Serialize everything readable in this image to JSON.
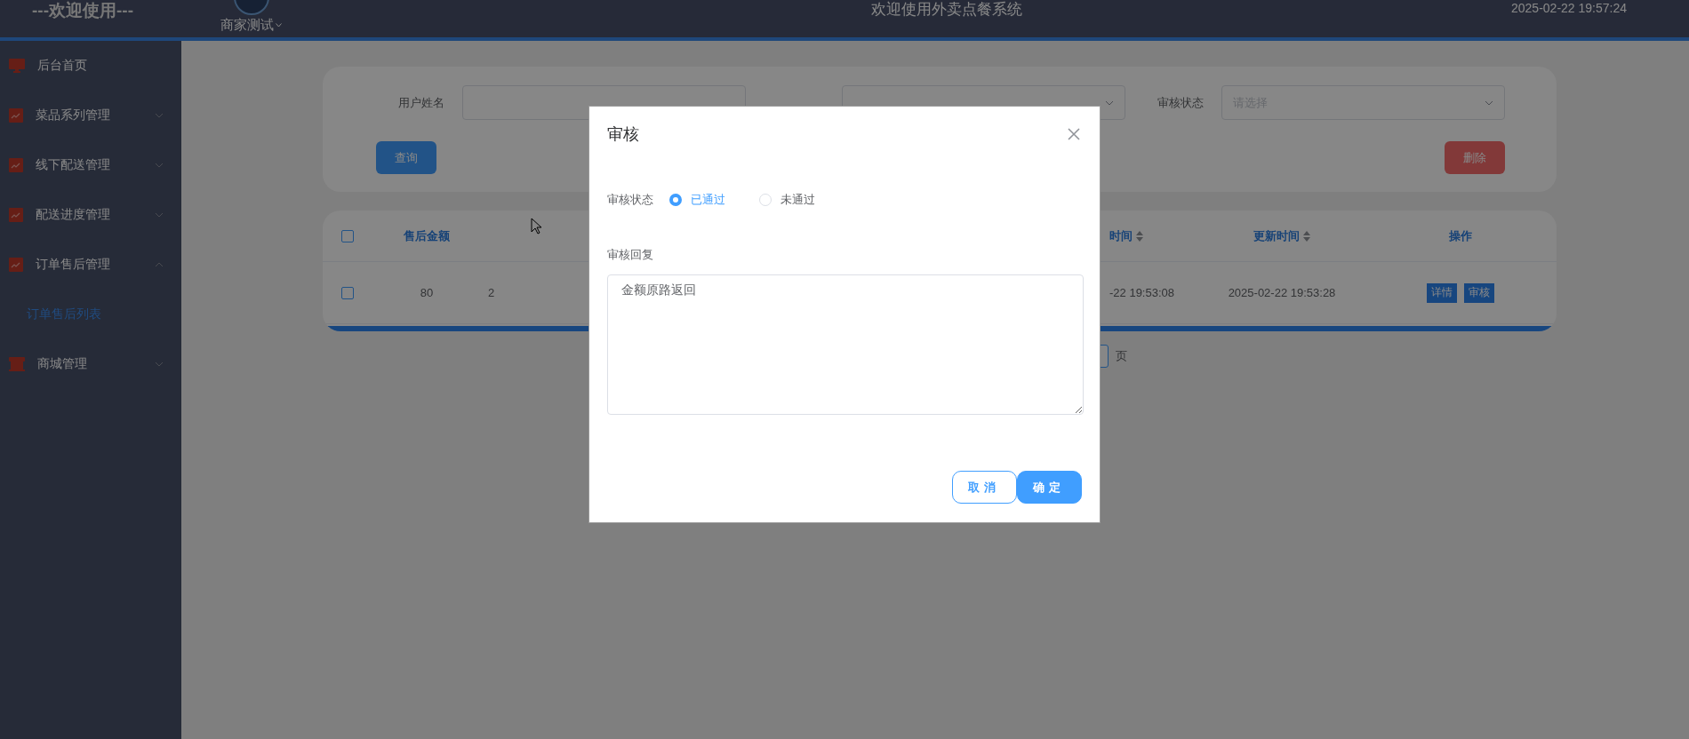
{
  "header": {
    "title": "---欢迎使用---",
    "user": "商家测试",
    "system_name": "欢迎使用外卖点餐系统",
    "datetime": "2025-02-22 19:57:24"
  },
  "sidebar": {
    "items": [
      {
        "label": "后台首页",
        "kind": "page"
      },
      {
        "label": "菜品系列管理",
        "kind": "menu",
        "expanded": false
      },
      {
        "label": "线下配送管理",
        "kind": "menu",
        "expanded": false
      },
      {
        "label": "配送进度管理",
        "kind": "menu",
        "expanded": false
      },
      {
        "label": "订单售后管理",
        "kind": "menu",
        "expanded": true,
        "children": [
          {
            "label": "订单售后列表",
            "selected": true
          }
        ]
      },
      {
        "label": "商城管理",
        "kind": "store",
        "expanded": false
      }
    ]
  },
  "filters": [
    {
      "label": "用户姓名",
      "kind": "text"
    },
    {
      "kind": "select"
    },
    {
      "label": "审核状态",
      "kind": "select",
      "placeholder": "请选择"
    }
  ],
  "filter_buttons": [
    {
      "label": "查询",
      "kind": "primary"
    },
    {
      "label": "删除",
      "kind": "danger"
    }
  ],
  "table": {
    "all_checked": false,
    "columns": [
      {
        "label": "售后金额",
        "sortable": false
      },
      {},
      {
        "label": "时间",
        "sortable": true
      },
      {
        "label": "更新时间",
        "sortable": true
      },
      {
        "label": "操作",
        "sortable": false
      }
    ],
    "rows": [
      {
        "checked": false,
        "cells": [
          "80",
          "2",
          "-22 19:53:08",
          "2025-02-22 19:53:28"
        ],
        "actions": [
          "详情",
          "审核"
        ]
      }
    ]
  },
  "pagination": {
    "suffix": "页"
  },
  "dialog": {
    "title": "审核",
    "status_label": "审核状态",
    "options": [
      {
        "label": "已通过",
        "selected": true
      },
      {
        "label": "未通过",
        "selected": false
      }
    ],
    "reply_label": "审核回复",
    "reply_value": "金额原路返回",
    "buttons": [
      {
        "label": "取消",
        "kind": "secondary"
      },
      {
        "label": "确定",
        "kind": "primary"
      }
    ]
  }
}
